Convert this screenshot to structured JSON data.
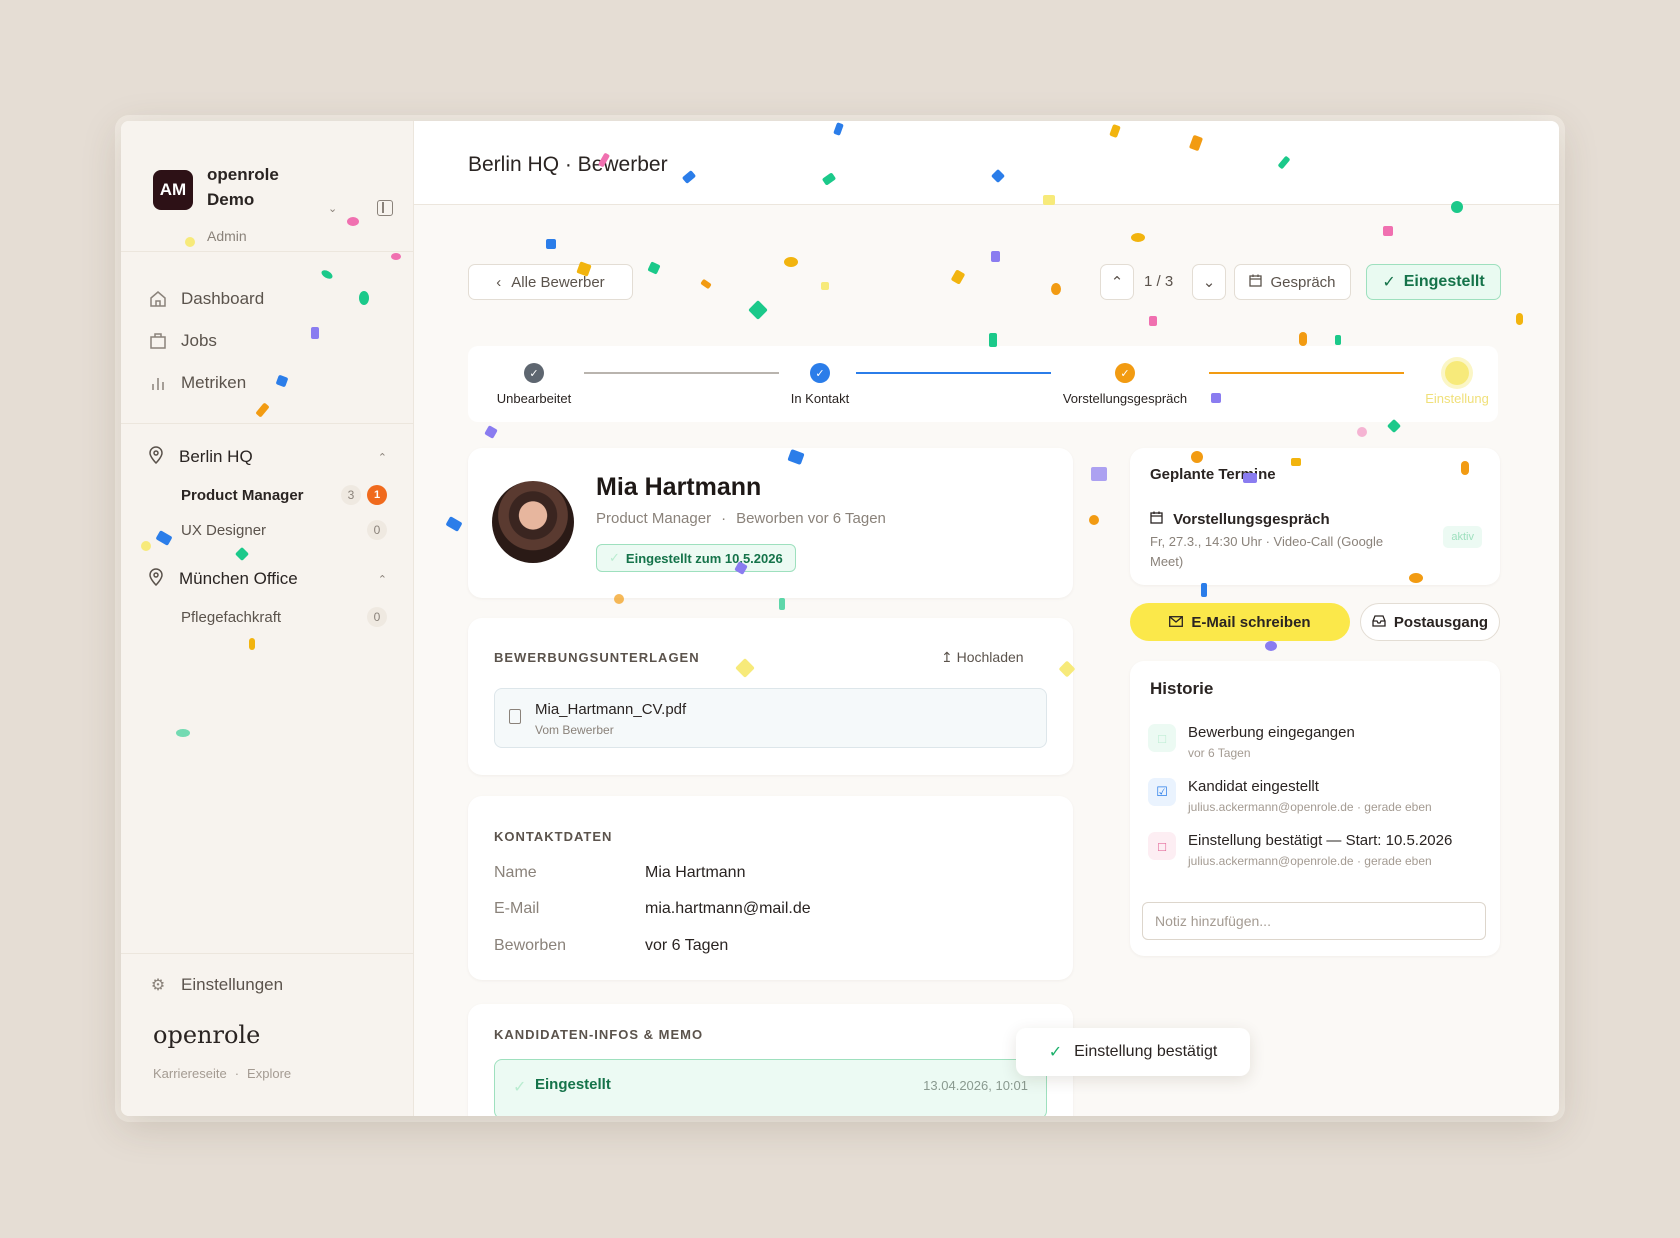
{
  "org": {
    "initials": "AM",
    "name": "openrole Demo",
    "role": "Admin"
  },
  "nav": [
    {
      "label": "Dashboard",
      "icon": "home-icon"
    },
    {
      "label": "Jobs",
      "icon": "briefcase-icon"
    },
    {
      "label": "Metriken",
      "icon": "bar-chart-icon"
    }
  ],
  "locations": [
    {
      "label": "Berlin HQ",
      "jobs": [
        {
          "label": "Product Manager",
          "count": "3",
          "new": "1"
        },
        {
          "label": "UX Designer",
          "count": "0"
        }
      ]
    },
    {
      "label": "München Office",
      "jobs": [
        {
          "label": "Pflegefachkraft",
          "count": "0"
        }
      ]
    }
  ],
  "settings_label": "Einstellungen",
  "brand": {
    "name": "openrole",
    "link1": "Karriereseite",
    "link2": "Explore"
  },
  "header": {
    "title": "Berlin HQ · Bewerber"
  },
  "toolbar": {
    "back_label": "Alle Bewerber",
    "pager": "1 / 3",
    "interview_label": "Gespräch",
    "hired_label": "Eingestellt"
  },
  "stages": [
    {
      "label": "Unbearbeitet",
      "color": "#5e6670"
    },
    {
      "label": "In Kontakt",
      "color": "#2b7de9"
    },
    {
      "label": "Vorstellungsgespräch",
      "color": "#f29b12"
    },
    {
      "label": "Einstellung",
      "color": "#f7ea7a"
    }
  ],
  "candidate": {
    "name": "Mia Hartmann",
    "position": "Product Manager",
    "applied": "Beworben vor 6 Tagen",
    "badge": "Eingestellt zum 10.5.2026"
  },
  "documents": {
    "title": "BEWERBUNGSUNTERLAGEN",
    "upload_label": "Hochladen",
    "file_name": "Mia_Hartmann_CV.pdf",
    "file_source": "Vom Bewerber"
  },
  "contact": {
    "title": "KONTAKTDATEN",
    "rows": [
      {
        "label": "Name",
        "value": "Mia Hartmann"
      },
      {
        "label": "E-Mail",
        "value": "mia.hartmann@mail.de"
      },
      {
        "label": "Beworben",
        "value": "vor 6 Tagen"
      }
    ]
  },
  "memo": {
    "title": "KANDIDATEN-INFOS & MEMO",
    "entry_title": "Eingestellt",
    "entry_time": "13.04.2026, 10:01"
  },
  "toast": "Einstellung bestätigt",
  "appointments": {
    "title": "Geplante Termine",
    "item_title": "Vorstellungsgespräch",
    "item_detail": "Fr, 27.3., 14:30 Uhr · Video-Call (Google Meet)",
    "item_status": "aktiv"
  },
  "actions": {
    "email_label": "E-Mail schreiben",
    "outbox_label": "Postausgang"
  },
  "history": {
    "title": "Historie",
    "items": [
      {
        "text": "Bewerbung eingegangen",
        "sub": "vor 6 Tagen"
      },
      {
        "text": "Kandidat eingestellt",
        "sub": "julius.ackermann@openrole.de · gerade eben"
      },
      {
        "text": "Einstellung bestätigt — Start: 10.5.2026",
        "sub": "julius.ackermann@openrole.de · gerade eben"
      }
    ],
    "note_placeholder": "Notiz hinzufügen..."
  },
  "colors": {
    "accent_green": "#15734a",
    "badge_new": "#f06a1d",
    "cta_yellow": "#fbe84a",
    "avatar_bg": "#2d1116"
  }
}
